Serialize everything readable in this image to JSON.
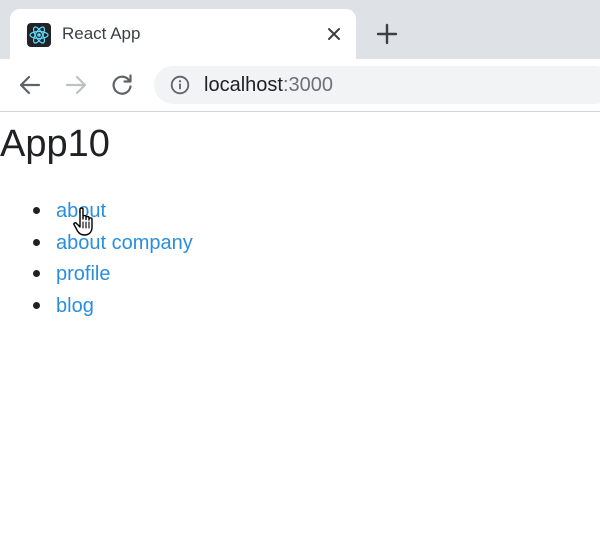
{
  "browser": {
    "tab": {
      "title": "React App",
      "favicon_icon": "react-logo-icon",
      "close_icon": "close-icon"
    },
    "new_tab_icon": "plus-icon",
    "toolbar": {
      "back_icon": "arrow-left-icon",
      "forward_icon": "arrow-right-icon",
      "reload_icon": "reload-icon",
      "info_icon": "info-icon",
      "url_host": "localhost",
      "url_port": ":3000"
    }
  },
  "page": {
    "title": "App10",
    "links": [
      {
        "label": "about"
      },
      {
        "label": "about company"
      },
      {
        "label": "profile"
      },
      {
        "label": "blog"
      }
    ]
  },
  "colors": {
    "link": "#2a8ee0",
    "tabstrip": "#dee1e6",
    "omnibox": "#f1f3f4",
    "text": "#202124",
    "react_logo": "#61dafb"
  },
  "cursor_icon": "hand-pointer-icon"
}
